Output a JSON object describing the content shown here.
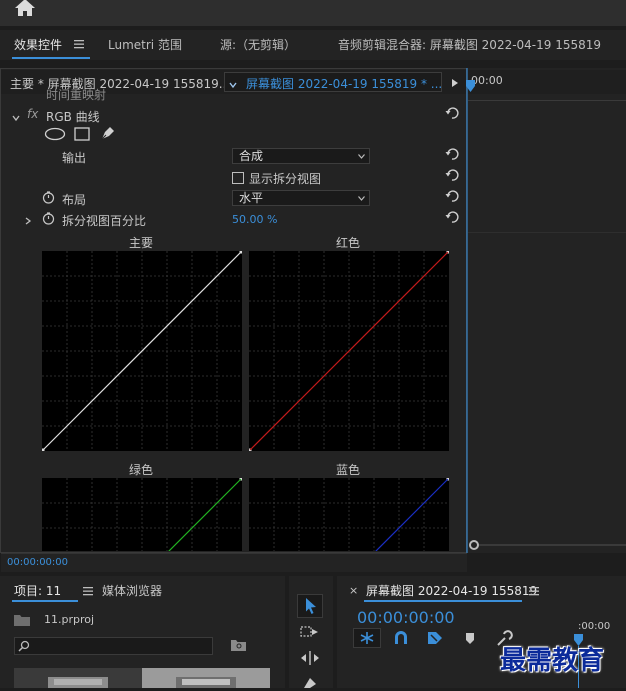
{
  "panel_tabs": {
    "effect_controls": "效果控件",
    "lumetri_scopes": "Lumetri 范围",
    "source": "源:（无剪辑）",
    "audio_mixer": "音频剪辑混合器: 屏幕截图 2022-04-19 155819"
  },
  "clip_bar": {
    "master_clip": "主要 * 屏幕截图 2022-04-19 155819...",
    "sequence_clip": "屏幕截图 2022-04-19 155819 * ...",
    "time_zero": "00:00"
  },
  "effect": {
    "prev_row": "时间重映射",
    "fx_badge": "fx",
    "name": "RGB 曲线",
    "output_label": "输出",
    "output_value": "合成",
    "split_view_label": "显示拆分视图",
    "layout_label": "布局",
    "layout_value": "水平",
    "split_pct_label": "拆分视图百分比",
    "split_pct_value": "50.00 %"
  },
  "curves": {
    "master": {
      "label": "主要",
      "color": "#e0e0e0"
    },
    "red": {
      "label": "红色",
      "color": "#c41a1a"
    },
    "green": {
      "label": "绿色",
      "color": "#22b322"
    },
    "blue": {
      "label": "蓝色",
      "color": "#1a2fc4"
    }
  },
  "panel_timecode": "00:00:00:00",
  "project": {
    "tab_label": "项目: 11",
    "media_browser": "媒体浏览器",
    "file_name": "11.prproj",
    "search_placeholder": ""
  },
  "sequence": {
    "title": "屏幕截图 2022-04-19 155819",
    "timecode": "00:00:00:00",
    "ruler_time": ":00:00"
  },
  "watermark": "最需教育",
  "colors": {
    "accent": "#3b8fd9"
  }
}
